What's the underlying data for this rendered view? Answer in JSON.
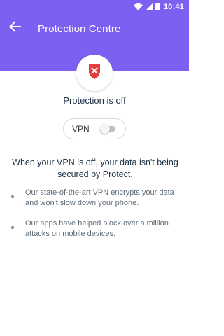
{
  "status_bar": {
    "time": "10:41",
    "icons": [
      "wifi-icon",
      "signal-icon",
      "battery-icon"
    ],
    "bg_color": "#7d60f1"
  },
  "header": {
    "title": "Protection Centre",
    "back_icon": "arrow-left-icon",
    "bg_color": "#7d60f1"
  },
  "status": {
    "badge_icon": "shield-x-icon",
    "badge_color": "#e33e3e",
    "title": "Protection is off"
  },
  "vpn": {
    "label": "VPN",
    "enabled": false
  },
  "warning": "When your VPN is off, your data isn't being secured by Protect.",
  "bullets": [
    "Our state-of-the-art VPN encrypts your data and won't slow down your phone.",
    "Our apps have helped block over a million attacks on mobile devices."
  ]
}
